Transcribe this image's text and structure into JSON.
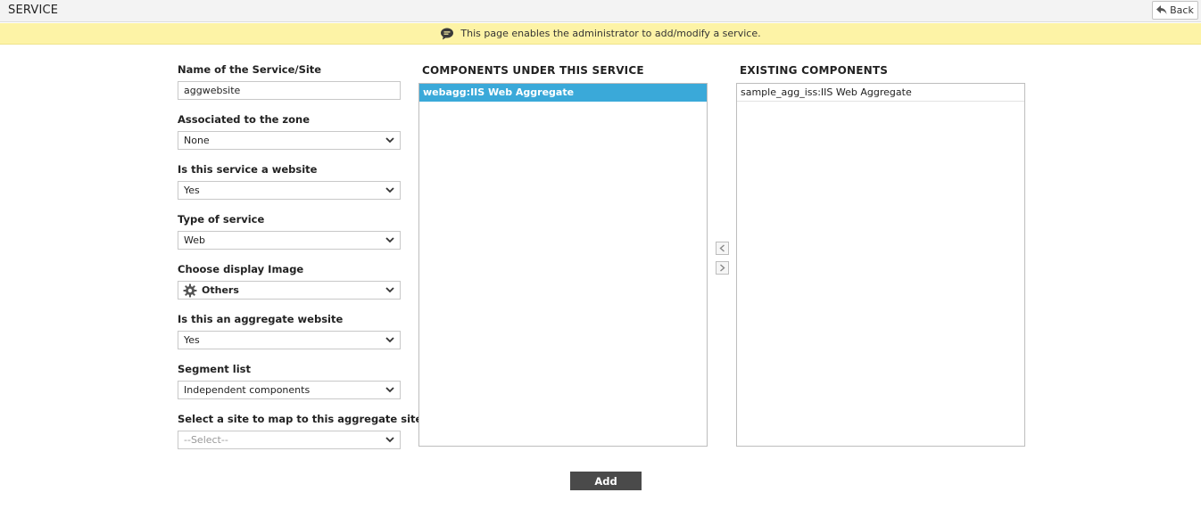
{
  "header": {
    "title": "SERVICE",
    "back_label": "Back"
  },
  "info": {
    "message": "This page enables the administrator to add/modify a service."
  },
  "form": {
    "service_name": {
      "label": "Name of the Service/Site",
      "value": "aggwebsite"
    },
    "zone": {
      "label": "Associated to the zone",
      "value": "None"
    },
    "is_website": {
      "label": "Is this service a website",
      "value": "Yes"
    },
    "service_type": {
      "label": "Type of service",
      "value": "Web"
    },
    "display_image": {
      "label": "Choose display Image",
      "value": "Others",
      "icon": "gear-icon"
    },
    "is_aggregate": {
      "label": "Is this an aggregate website",
      "value": "Yes"
    },
    "segment_list": {
      "label": "Segment list",
      "value": "Independent components"
    },
    "map_site": {
      "label": "Select a site to map to this aggregate site",
      "value": "--Select--"
    }
  },
  "components_under_service": {
    "title": "COMPONENTS UNDER THIS SERVICE",
    "items": [
      "webagg:IIS Web Aggregate"
    ]
  },
  "existing_components": {
    "title": "EXISTING COMPONENTS",
    "items": [
      "sample_agg_iss:IIS Web Aggregate"
    ]
  },
  "actions": {
    "add_label": "Add"
  },
  "colors": {
    "accent": "#3aa9d9",
    "info_bg": "#fdf3a6",
    "button_dark": "#4a4a4a"
  }
}
